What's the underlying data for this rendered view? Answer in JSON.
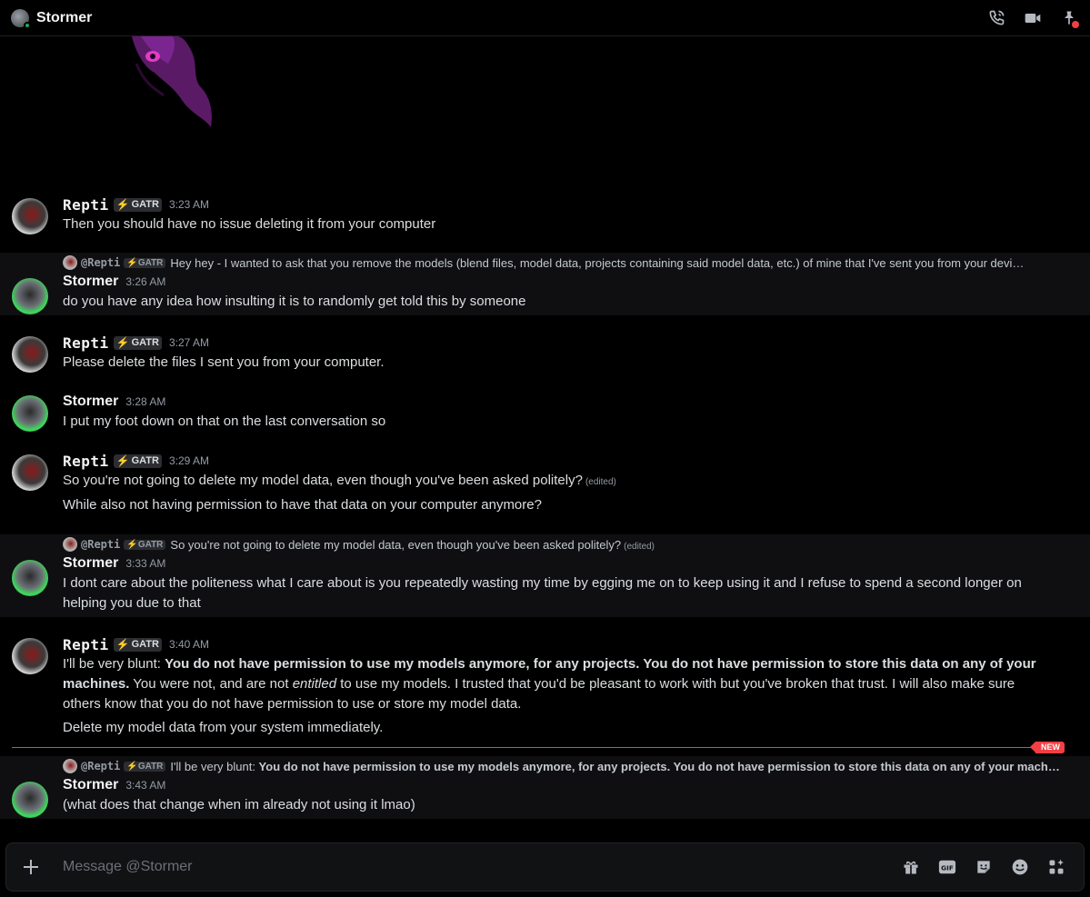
{
  "header": {
    "title": "Stormer"
  },
  "composer": {
    "placeholder": "Message @Stormer"
  },
  "new_label": "NEW",
  "messages": [
    {
      "author": "Repti",
      "tag": "GATR",
      "time": "3:23 AM",
      "lines": [
        "Then you should have no issue deleting it from your computer"
      ]
    },
    {
      "author": "Stormer",
      "time": "3:26 AM",
      "reply": {
        "author": "@Repti",
        "tag": "GATR",
        "text": "Hey hey - I wanted to ask that you remove the models (blend files, model data, projects containing said model data, etc.) of mine that I've sent you from your devi…"
      },
      "lines": [
        "do you have any idea how insulting it is to randomly get told this by someone"
      ]
    },
    {
      "author": "Repti",
      "tag": "GATR",
      "time": "3:27 AM",
      "lines": [
        "Please delete the files I sent you from your computer."
      ]
    },
    {
      "author": "Stormer",
      "time": "3:28 AM",
      "lines": [
        "I put my foot down on that on the last conversation so"
      ]
    },
    {
      "author": "Repti",
      "tag": "GATR",
      "time": "3:29 AM",
      "lines": [
        "So you're not going to delete my model data, even though you've been asked politely?",
        "While also not having permission to have that data on your computer anymore?"
      ],
      "edited": "(edited)"
    },
    {
      "author": "Stormer",
      "time": "3:33 AM",
      "reply": {
        "author": "@Repti",
        "tag": "GATR",
        "text": "So you're not going to delete my model data, even though you've been asked politely?",
        "edited": "(edited)"
      },
      "lines": [
        "I dont care about the politeness what I care about is you repeatedly wasting my time by egging me on to keep using it and I refuse to spend a second longer on helping you due to that"
      ]
    },
    {
      "author": "Repti",
      "tag": "GATR",
      "time": "3:40 AM",
      "parts": {
        "p1": "I'll be very blunt: ",
        "b1": "You do not have permission to use my models anymore, for any projects. You do not have permission to store this data on any of your machines.",
        "p2": " You were not, and are not ",
        "i1": "entitled",
        "p3": " to use my models. I trusted that you'd be pleasant to work with but you've broken that trust. I will also make sure others know that you do not have permission to use or store my model data."
      },
      "lines": [
        "Delete my model data from your system immediately."
      ]
    },
    {
      "author": "Stormer",
      "time": "3:43 AM",
      "reply": {
        "author": "@Repti",
        "tag": "GATR",
        "prefix": "I'll be very blunt: ",
        "bold": "You do not have permission to use my models anymore, for any projects. You do not have permission to store this data on any of your mach…"
      },
      "lines": [
        "(what does that change when im already not using it lmao)"
      ]
    }
  ],
  "colors": {
    "background": "#000000",
    "accent_red": "#f23f43",
    "online_green": "#23a55a",
    "tag_bolt": "#f0b232"
  },
  "icons": [
    "phone-call-icon",
    "video-camera-icon",
    "pin-icon",
    "plus-icon",
    "gift-icon",
    "gif-icon",
    "sticker-icon",
    "emoji-icon",
    "apps-icon"
  ]
}
